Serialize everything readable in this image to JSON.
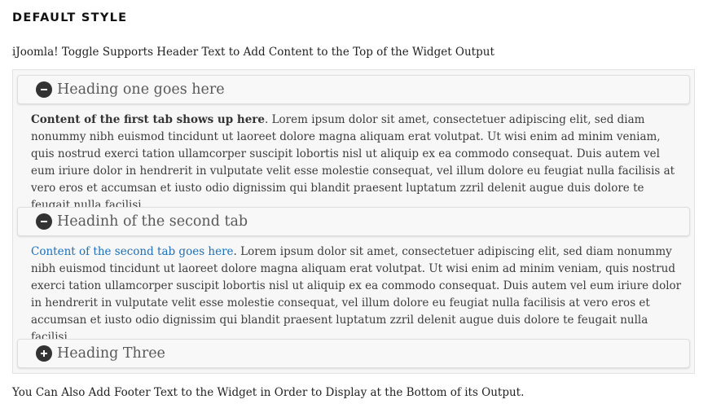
{
  "page_title": "DEFAULT STYLE",
  "header_text": "iJoomla! Toggle Supports Header Text to Add Content to the Top of the Widget Output",
  "tabs": [
    {
      "title": "Heading one goes here",
      "icon": "minus-icon",
      "expanded": true,
      "lead": "Content of the first tab shows up here",
      "body": ". Lorem ipsum dolor sit amet, consectetuer adipiscing elit, sed diam nonummy nibh euismod tincidunt ut laoreet dolore magna aliquam erat volutpat. Ut wisi enim ad minim veniam, quis nostrud exerci tation ullamcorper suscipit lobortis nisl ut aliquip ex ea commodo consequat. Duis autem vel eum iriure dolor in hendrerit in vulputate velit esse molestie consequat, vel illum dolore eu feugiat nulla facilisis at vero eros et accumsan et iusto odio dignissim qui blandit praesent luptatum zzril delenit augue duis dolore te feugait nulla facilisi."
    },
    {
      "title": "Headinh of the second tab",
      "icon": "minus-icon",
      "expanded": true,
      "lead": "Content of the second tab goes here",
      "body": ". Lorem ipsum dolor sit amet, consectetuer adipiscing elit, sed diam nonummy nibh euismod tincidunt ut laoreet dolore magna aliquam erat volutpat. Ut wisi enim ad minim veniam, quis nostrud exerci tation ullamcorper suscipit lobortis nisl ut aliquip ex ea commodo consequat. Duis autem vel eum iriure dolor in hendrerit in vulputate velit esse molestie consequat, vel illum dolore eu feugiat nulla facilisis at vero eros et accumsan et iusto odio dignissim qui blandit praesent luptatum zzril delenit augue duis dolore te feugait nulla facilisi."
    },
    {
      "title": "Heading Three",
      "icon": "plus-icon",
      "expanded": false
    }
  ],
  "footer_text": "You Can Also Add Footer Text to the Widget in Order to Display at the Bottom of its Output.",
  "colors": {
    "link": "#1d6fb8",
    "icon_bg": "#333333",
    "heading_text": "#595959",
    "widget_bg": "#f7f7f7"
  }
}
